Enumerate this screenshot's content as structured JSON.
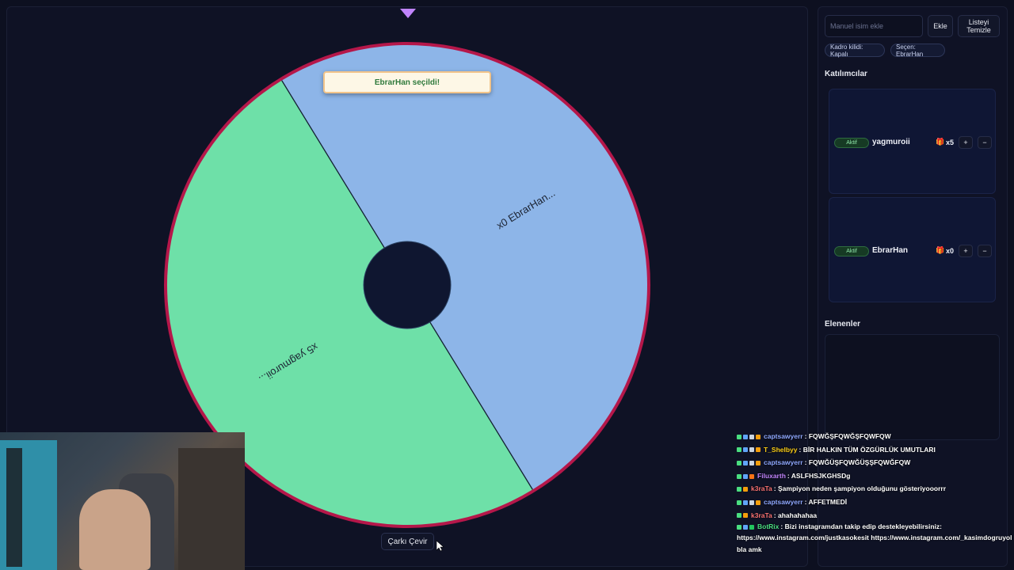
{
  "wheel": {
    "segments": [
      {
        "label": "x0 EbrarHan...",
        "color": "#8db5e8"
      },
      {
        "label": "x5 yagmuroii...",
        "color": "#6ee0a8"
      }
    ],
    "rim_color": "#b5174a",
    "hub_color": "#0f1630",
    "toast": "EbrarHan seçildi!",
    "spin_button": "Çarkı Çevir"
  },
  "panel": {
    "name_input": {
      "placeholder": "Manuel isim ekle",
      "value": ""
    },
    "add_button": "Ekle",
    "clear_button": "Listeyi Temizle",
    "lock_pill": "Kadro kilidi: Kapalı",
    "selected_pill": "Seçen: EbrarHan",
    "participants_title": "Katılımcılar",
    "participants": [
      {
        "status": "Aktif",
        "name": "yagmuroii",
        "gift_icon": "gift-icon",
        "count": "x5",
        "plus": "+",
        "minus": "−"
      },
      {
        "status": "Aktif",
        "name": "EbrarHan",
        "gift_icon": "gift-icon",
        "count": "x0",
        "plus": "+",
        "minus": "−"
      }
    ],
    "eliminated_title": "Elenenler"
  },
  "chat": [
    {
      "user": "captsawyerr",
      "color": "#8fa8ff",
      "badges": [
        "#4ade80",
        "#60a5fa",
        "#cbd5e1",
        "#f59e0b"
      ],
      "text": "FQWĞŞFQWĞŞFQWFQW"
    },
    {
      "user": "T_Shelbyy",
      "color": "#facc15",
      "badges": [
        "#4ade80",
        "#60a5fa",
        "#cbd5e1",
        "#f59e0b"
      ],
      "text": "BİR HALKIN TÜM ÖZGÜRLÜK UMUTLARI"
    },
    {
      "user": "captsawyerr",
      "color": "#8fa8ff",
      "badges": [
        "#4ade80",
        "#60a5fa",
        "#cbd5e1",
        "#f59e0b"
      ],
      "text": "FQWĞÜŞFQWĞÜŞŞFQWĞFQW"
    },
    {
      "user": "Filuxarth",
      "color": "#c084fc",
      "badges": [
        "#4ade80",
        "#60a5fa",
        "#f97316"
      ],
      "text": "ASLFHSJKGHSDg"
    },
    {
      "user": "k3raTa",
      "color": "#f87171",
      "badges": [
        "#4ade80",
        "#f59e0b"
      ],
      "text": "Şampiyon neden şampiyon olduğunu gösteriyooorrr"
    },
    {
      "user": "captsawyerr",
      "color": "#8fa8ff",
      "badges": [
        "#4ade80",
        "#60a5fa",
        "#cbd5e1",
        "#f59e0b"
      ],
      "text": "AFFETMEDİ"
    },
    {
      "user": "k3raTa",
      "color": "#f87171",
      "badges": [
        "#4ade80",
        "#f59e0b"
      ],
      "text": "ahahahahaa"
    },
    {
      "user": "BotRix",
      "color": "#4ade80",
      "badges": [
        "#4ade80",
        "#60a5fa",
        "#22c55e"
      ],
      "text": "Bizi instagramdan takip edip destekleyebilirsiniz: https://www.instagram.com/justkasokesit https://www.instagram.com/_kasimdogruyol"
    },
    {
      "user": "",
      "color": "#ffffff",
      "badges": [],
      "text": "bla amk"
    }
  ]
}
